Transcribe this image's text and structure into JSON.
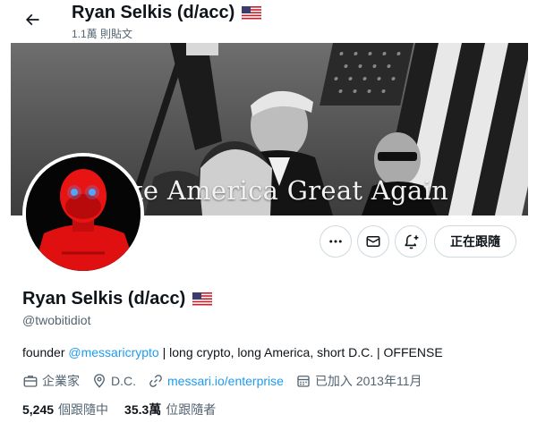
{
  "header": {
    "name": "Ryan Selkis (d/acc)",
    "post_count": "1.1萬 則貼文",
    "back_icon": "arrow-left-icon"
  },
  "banner": {
    "text": "ke America Great Again"
  },
  "actions": {
    "more_icon": "more-dots-icon",
    "message_icon": "envelope-icon",
    "notify_icon": "bell-plus-icon",
    "follow_label": "正在跟隨"
  },
  "profile": {
    "name": "Ryan Selkis (d/acc)",
    "handle": "@twobitidiot",
    "flag_icon": "us-flag-icon",
    "bio": {
      "prefix": "founder ",
      "mention": "@messaricrypto",
      "suffix": " | long crypto, long America, short D.C. | OFFENSE"
    },
    "meta": {
      "profession": "企業家",
      "location": "D.C.",
      "website": "messari.io/enterprise",
      "joined": "已加入 2013年11月"
    },
    "stats": {
      "following_count": "5,245",
      "following_label": "個跟隨中",
      "followers_count": "35.3萬",
      "followers_label": "位跟隨者"
    }
  },
  "colors": {
    "accent": "#1d9bf0",
    "secondary_text": "#536471",
    "border": "#cfd9de",
    "avatar_red": "#e01010"
  }
}
